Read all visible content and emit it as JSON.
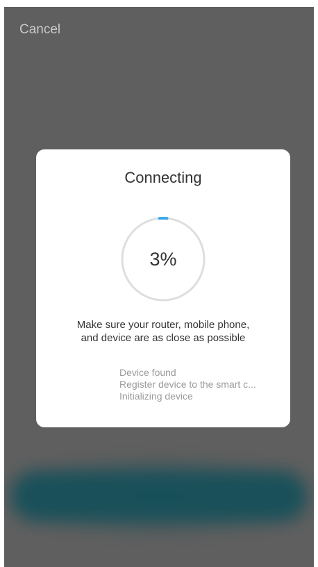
{
  "header": {
    "cancel_label": "Cancel"
  },
  "dialog": {
    "title": "Connecting",
    "progress": {
      "percent_label": "3%",
      "value": 0.03,
      "track_color": "#dedede",
      "fill_color": "#3aa8e6"
    },
    "hint_line_1": "Make sure your router, mobile phone,",
    "hint_line_2": "and device are as close as possible",
    "steps": [
      "Device found",
      "Register device to the smart c...",
      "Initializing device"
    ]
  },
  "colors": {
    "overlay": "#5f5f5f",
    "dialog_bg": "#ffffff",
    "blurred_button": "#17505a"
  }
}
